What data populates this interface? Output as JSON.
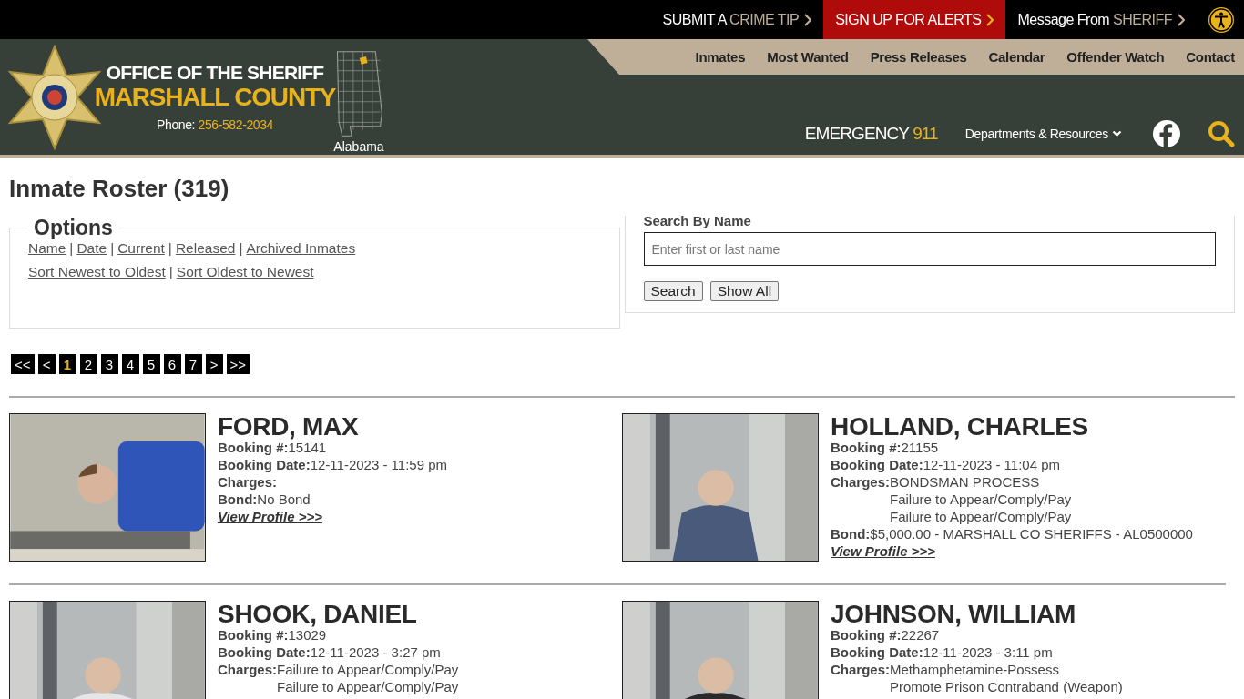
{
  "top_bar": {
    "links": [
      {
        "kind": "plain",
        "lead": "SUBMIT A",
        "accent": "CRIME TIP"
      },
      {
        "kind": "alert",
        "lead": "SIGN UP FOR ALERTS"
      },
      {
        "kind": "plain",
        "lead": "Message From",
        "accent": "SHERIFF"
      }
    ]
  },
  "header": {
    "title": "OFFICE OF THE SHERIFF",
    "county": "MARSHALL COUNTY",
    "phone_label": "Phone:",
    "phone": "256-582-2034",
    "state": "Alabama"
  },
  "nav": {
    "items": [
      "Inmates",
      "Most Wanted",
      "Press Releases",
      "Calendar",
      "Offender Watch",
      "Contact"
    ],
    "emergency_label": "EMERGENCY",
    "emergency_number": "911",
    "departments": "Departments & Resources"
  },
  "page_title": "Inmate Roster (319)",
  "options": {
    "legend": "Options",
    "separator": "|",
    "filter_links": [
      "Name",
      "Date",
      "Current",
      "Released",
      "Archived Inmates"
    ],
    "sort_links": [
      "Sort Newest to Oldest",
      "Sort Oldest to Newest"
    ]
  },
  "search": {
    "label": "Search By Name",
    "placeholder": "Enter first or last name",
    "buttons": [
      "Search",
      "Show All"
    ]
  },
  "pages": [
    {
      "label": "<<",
      "selected": false
    },
    {
      "label": "<",
      "selected": false
    },
    {
      "label": "1",
      "selected": true
    },
    {
      "label": "2",
      "selected": false
    },
    {
      "label": "3",
      "selected": false
    },
    {
      "label": "4",
      "selected": false
    },
    {
      "label": "5",
      "selected": false
    },
    {
      "label": "6",
      "selected": false
    },
    {
      "label": "7",
      "selected": false
    },
    {
      "label": ">",
      "selected": false
    },
    {
      "label": ">>",
      "selected": false
    }
  ],
  "inmates": [
    {
      "name": "FORD, MAX",
      "booking_label": "Booking #:",
      "booking": "15141",
      "date_label": "Booking Date:",
      "date": "12-11-2023 - 11:59 pm",
      "charges_label": "Charges:",
      "bond_label": "Bond:",
      "bond": "No Bond",
      "link": "View Profile >>>"
    },
    {
      "name": "HOLLAND, CHARLES",
      "booking_label": "Booking #:",
      "booking": "21155",
      "date_label": "Booking Date:",
      "date": "12-11-2023 - 11:04 pm",
      "charges_label": "Charges:",
      "charges": [
        "BONDSMAN PROCESS",
        "Failure to Appear/Comply/Pay",
        "Failure to Appear/Comply/Pay"
      ],
      "bond_label": "Bond:",
      "bond": "$5,000.00 - MARSHALL CO SHERIFFS - AL0500000",
      "link": "View Profile >>>"
    },
    {
      "name": "SHOOK, DANIEL",
      "booking_label": "Booking #:",
      "booking": "13029",
      "date_label": "Booking Date:",
      "date": "12-11-2023 - 3:27 pm",
      "charges_label": "Charges:",
      "charges": [
        "Failure to Appear/Comply/Pay",
        "Failure to Appear/Comply/Pay"
      ]
    },
    {
      "name": "JOHNSON, WILLIAM",
      "booking_label": "Booking #:",
      "booking": "22267",
      "date_label": "Booking Date:",
      "date": "12-11-2023 - 3:11 pm",
      "charges_label": "Charges:",
      "charges": [
        "Methamphetamine-Possess",
        "Promote Prison Contraband (Weapon)"
      ]
    }
  ]
}
